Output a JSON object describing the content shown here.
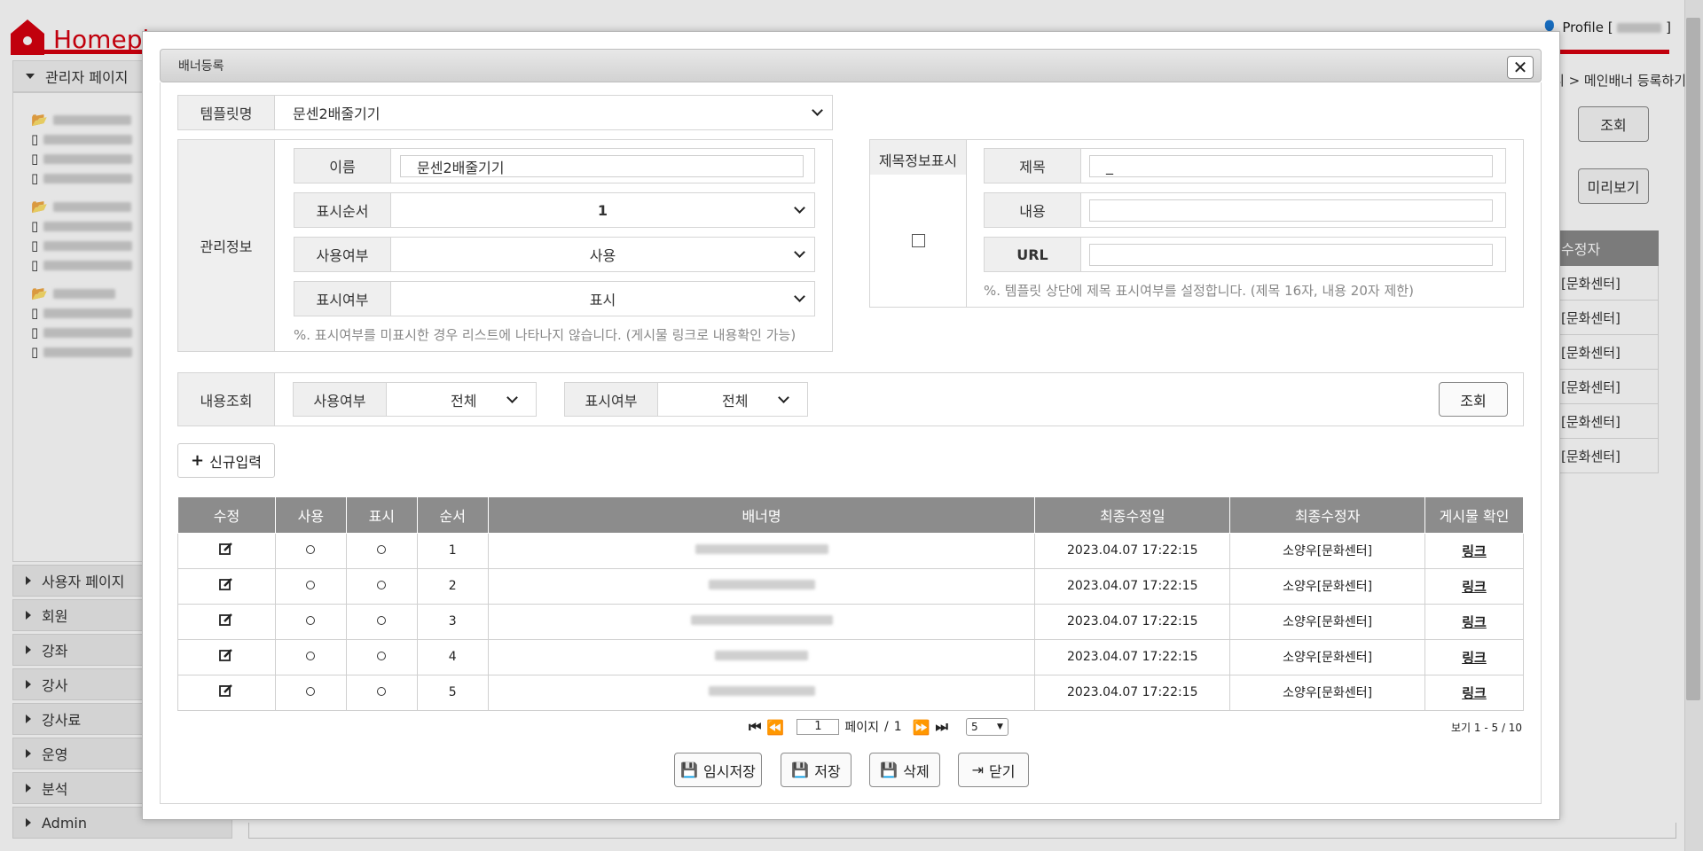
{
  "app": {
    "logo_text": "Homeplus",
    "profile_label": "Profile [",
    "profile_close": "]"
  },
  "sidebar": {
    "admin_page": "관리자 페이지",
    "menu": [
      "사용자 페이지",
      "회원",
      "강좌",
      "강사",
      "강사료",
      "운영",
      "분석",
      "Admin"
    ]
  },
  "background": {
    "breadcrumb": "리 > 메인배너 등록하기",
    "search_btn": "조회",
    "preview_btn": "미리보기",
    "table_header": "수정자",
    "table_rows": [
      "[문화센터]",
      "[문화센터]",
      "[문화센터]",
      "[문화센터]",
      "[문화센터]",
      "[문화센터]"
    ]
  },
  "modal": {
    "title": "배너등록",
    "close": "✕",
    "template_label": "템플릿명",
    "template_value": "문센2배줄기기",
    "mgmt_label": "관리정보",
    "name_label": "이름",
    "name_value": "문센2배줄기기",
    "order_label": "표시순서",
    "order_value": "1",
    "use_label": "사용여부",
    "use_value": "사용",
    "display_label": "표시여부",
    "display_value": "표시",
    "mgmt_note": "%. 표시여부를 미표시한 경우 리스트에 나타나지 않습니다. (게시물 링크로 내용확인 가능)",
    "title_info_label": "제목정보표시",
    "subject_label": "제목",
    "subject_value": "_",
    "content_label": "내용",
    "content_value": "",
    "url_label": "URL",
    "url_value": "",
    "title_note": "%. 템플릿 상단에 제목 표시여부를 설정합니다. (제목 16자, 내용 20자 제한)",
    "query_label": "내용조회",
    "filter_use_label": "사용여부",
    "filter_use_value": "전체",
    "filter_display_label": "표시여부",
    "filter_display_value": "전체",
    "query_btn": "조회",
    "new_btn": "신규입력",
    "table": {
      "headers": [
        "수정",
        "사용",
        "표시",
        "순서",
        "배너명",
        "최종수정일",
        "최종수정자",
        "게시물 확인"
      ],
      "rows": [
        {
          "order": "1",
          "date": "2023.04.07 17:22:15",
          "editor": "소양우[문화센터]",
          "link": "링크"
        },
        {
          "order": "2",
          "date": "2023.04.07 17:22:15",
          "editor": "소양우[문화센터]",
          "link": "링크"
        },
        {
          "order": "3",
          "date": "2023.04.07 17:22:15",
          "editor": "소양우[문화센터]",
          "link": "링크"
        },
        {
          "order": "4",
          "date": "2023.04.07 17:22:15",
          "editor": "소양우[문화센터]",
          "link": "링크"
        },
        {
          "order": "5",
          "date": "2023.04.07 17:22:15",
          "editor": "소양우[문화센터]",
          "link": "링크"
        }
      ]
    },
    "pager": {
      "page": "1",
      "page_label": "페이지",
      "slash": "/",
      "total": "1",
      "per_page": "5",
      "view_info": "보기 1 - 5 / 10"
    },
    "footer": {
      "temp_save": "임시저장",
      "save": "저장",
      "delete": "삭제",
      "close": "닫기"
    }
  },
  "colors": {
    "brand": "#d7000f",
    "header_bg": "#8c8c8c"
  }
}
